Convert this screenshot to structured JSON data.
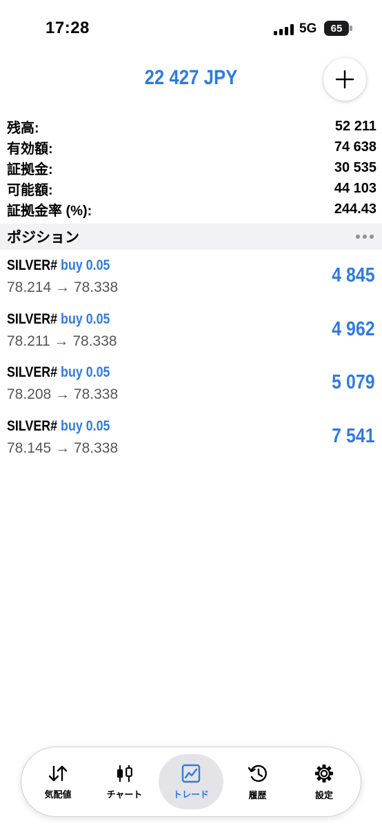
{
  "status_bar": {
    "time": "17:28",
    "network": "5G",
    "battery": "65"
  },
  "header": {
    "balance": "22 427 JPY",
    "add_icon": "plus-icon"
  },
  "account": [
    {
      "label": "残高:",
      "value": "52 211"
    },
    {
      "label": "有効額:",
      "value": "74 638"
    },
    {
      "label": "証拠金:",
      "value": "30 535"
    },
    {
      "label": "可能額:",
      "value": "44 103"
    },
    {
      "label": "証拠金率 (%):",
      "value": "244.43"
    }
  ],
  "positions_section": {
    "title": "ポジション",
    "menu_icon": "more-icon"
  },
  "positions": [
    {
      "symbol": "SILVER#",
      "side": "buy 0.05",
      "prices": "78.214 → 78.338",
      "profit": "4 845"
    },
    {
      "symbol": "SILVER#",
      "side": "buy 0.05",
      "prices": "78.211 → 78.338",
      "profit": "4 962"
    },
    {
      "symbol": "SILVER#",
      "side": "buy 0.05",
      "prices": "78.208 → 78.338",
      "profit": "5 079"
    },
    {
      "symbol": "SILVER#",
      "side": "buy 0.05",
      "prices": "78.145 → 78.338",
      "profit": "7 541"
    }
  ],
  "tabs": [
    {
      "label": "気配値",
      "icon": "quotes-icon",
      "active": false
    },
    {
      "label": "チャート",
      "icon": "chart-icon",
      "active": false
    },
    {
      "label": "トレード",
      "icon": "trade-icon",
      "active": true
    },
    {
      "label": "履歴",
      "icon": "history-icon",
      "active": false
    },
    {
      "label": "設定",
      "icon": "settings-icon",
      "active": false
    }
  ],
  "colors": {
    "accent": "#2f7be0",
    "section_bg": "#f2f2f4",
    "active_tab_bg": "#e4e4e8"
  }
}
